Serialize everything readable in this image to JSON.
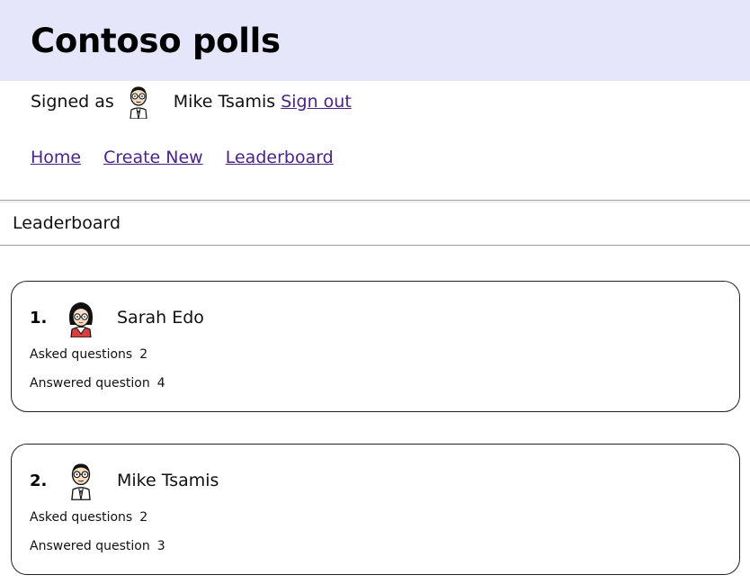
{
  "header": {
    "title": "Contoso polls"
  },
  "user_bar": {
    "signed_label": "Signed as",
    "user_name": "Mike Tsamis",
    "avatar_icon": "man-with-glasses-avatar-icon",
    "sign_out_label": "Sign out"
  },
  "nav": {
    "items": [
      {
        "label": "Home"
      },
      {
        "label": "Create New"
      },
      {
        "label": "Leaderboard"
      }
    ]
  },
  "page": {
    "section_title": "Leaderboard"
  },
  "leaderboard": {
    "entries": [
      {
        "rank": "1.",
        "name": "Sarah Edo",
        "avatar_icon": "woman-with-glasses-avatar-icon",
        "asked_label": "Asked questions",
        "asked_value": "2",
        "answered_label": "Answered question",
        "answered_value": "4"
      },
      {
        "rank": "2.",
        "name": "Mike Tsamis",
        "avatar_icon": "man-with-glasses-avatar-icon",
        "asked_label": "Asked questions",
        "asked_value": "2",
        "answered_label": "Answered question",
        "answered_value": "3"
      }
    ]
  },
  "colors": {
    "header_background": "#e6e6fa",
    "link": "#4b2386",
    "card_border": "#222222"
  }
}
